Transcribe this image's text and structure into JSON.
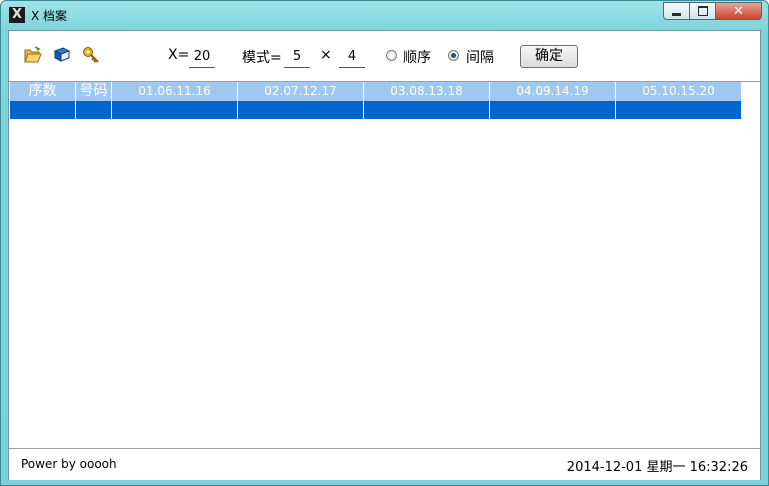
{
  "window": {
    "title": "X 档案",
    "app_icon_glyph": "X"
  },
  "toolbar": {
    "icons": [
      "folder-open-icon",
      "book-icon",
      "key-icon"
    ],
    "x_label": "X=",
    "x_value": "20",
    "mode_label": "模式=",
    "mode_rows": "5",
    "times_symbol": "×",
    "mode_cols": "4",
    "radio_sequential_label": "顺序",
    "radio_interval_label": "间隔",
    "selected_radio": "间隔",
    "confirm_label": "确定"
  },
  "table": {
    "columns": [
      "序数",
      "号码",
      "01.06.11.16",
      "02.07.12.17",
      "03.08.13.18",
      "04.09.14.19",
      "05.10.15.20"
    ],
    "rows": [
      {
        "selected": true,
        "cells": [
          "",
          "",
          "",
          "",
          "",
          "",
          ""
        ]
      }
    ],
    "header_color": "#9fc8f0",
    "selection_color": "#0066cc"
  },
  "status": {
    "left": "Power by ooooh",
    "right": "2014-12-01 星期一 16:32:26"
  }
}
